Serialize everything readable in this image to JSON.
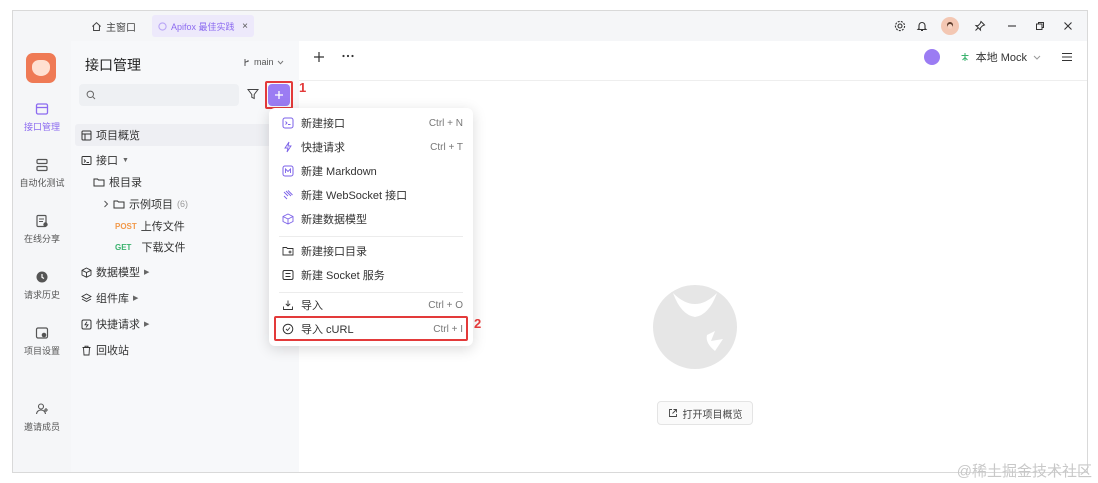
{
  "titlebar": {
    "home_tab": "主窗口",
    "project_tab": "Apifox 最佳实践",
    "close_glyph": "×"
  },
  "leftnav": {
    "items": [
      {
        "label": "接口管理",
        "icon": "api-management-icon",
        "active": true
      },
      {
        "label": "自动化测试",
        "icon": "automation-icon",
        "active": false
      },
      {
        "label": "在线分享",
        "icon": "share-icon",
        "active": false
      },
      {
        "label": "请求历史",
        "icon": "history-icon",
        "active": false
      },
      {
        "label": "项目设置",
        "icon": "settings-icon",
        "active": false
      },
      {
        "label": "邀请成员",
        "icon": "invite-member-icon",
        "active": false
      }
    ]
  },
  "sidebar": {
    "title": "接口管理",
    "branch": "main",
    "tree": {
      "overview": "项目概览",
      "apis": "接口",
      "root": "根目录",
      "example": "示例项目",
      "example_count": "(6)",
      "post_method": "POST",
      "post_label": "上传文件",
      "get_method": "GET",
      "get_label": "下载文件",
      "schemas": "数据模型",
      "components": "组件库",
      "quick_requests": "快捷请求",
      "trash": "回收站"
    }
  },
  "annotations": {
    "step1": "1",
    "step2": "2"
  },
  "main": {
    "environment": "本地 Mock",
    "open_overview": "打开项目概览"
  },
  "dropdown": {
    "new_api": "新建接口",
    "new_api_shortcut": "Ctrl + N",
    "quick_request": "快捷请求",
    "quick_request_shortcut": "Ctrl + T",
    "new_markdown": "新建 Markdown",
    "new_websocket": "新建 WebSocket 接口",
    "new_schema": "新建数据模型",
    "new_folder": "新建接口目录",
    "new_socket": "新建 Socket 服务",
    "import": "导入",
    "import_shortcut": "Ctrl + O",
    "import_curl": "导入 cURL",
    "import_curl_shortcut": "Ctrl + I"
  },
  "watermark": "@稀土掘金技术社区",
  "colors": {
    "accent": "#9b7cf3",
    "annotation_red": "#e33a3a",
    "post": "#f2994a",
    "get": "#3ab26d"
  }
}
